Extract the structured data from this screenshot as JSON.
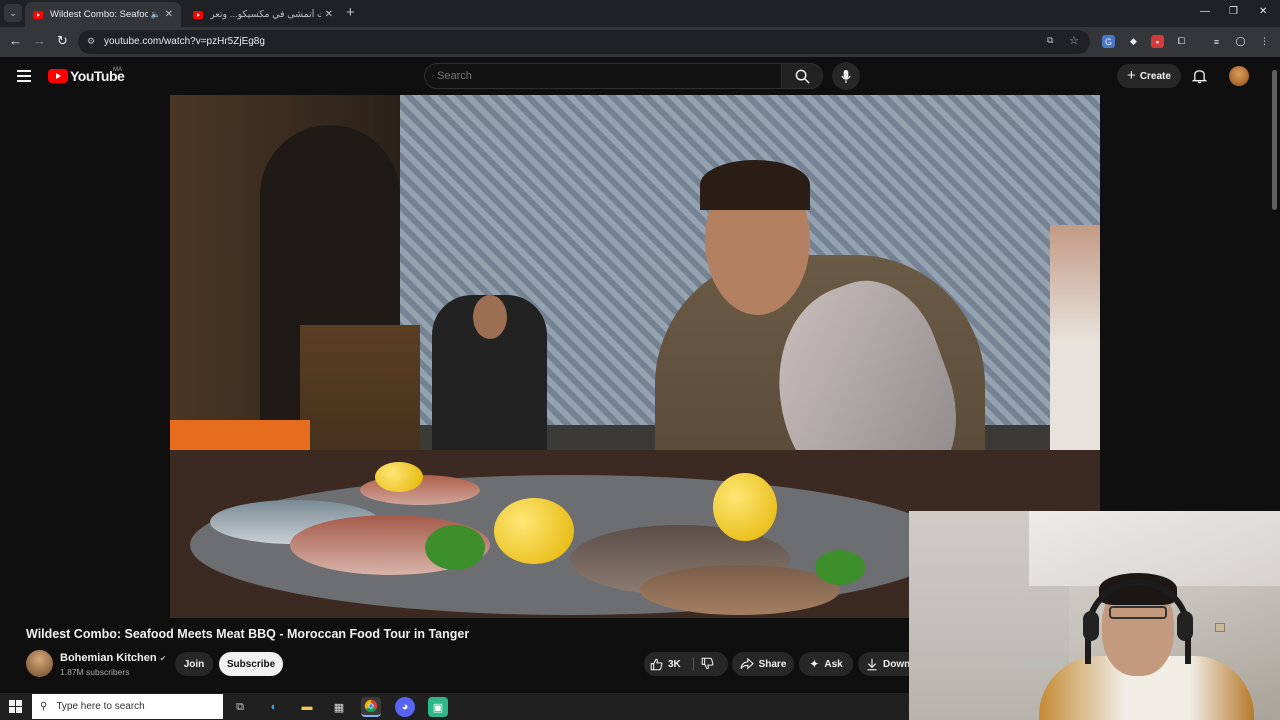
{
  "browser": {
    "tabs": [
      {
        "title": "Wildest Combo: Seafood M",
        "active": true
      },
      {
        "title": "خرجت أتمشى في مكسيكو... وتعر",
        "active": false
      }
    ],
    "tab_menu_icon": "chevron-down-icon",
    "new_tab_label": "+",
    "window_controls": [
      "—",
      "❐",
      "✕"
    ],
    "url": "youtube.com/watch?v=pzHr5ZjEg8g"
  },
  "youtube": {
    "logo_text": "YouTube",
    "country_code": "MA",
    "search_placeholder": "Search",
    "create_label": "Create"
  },
  "video": {
    "title": "Wildest Combo: Seafood Meets Meat BBQ - Moroccan Food Tour in Tanger",
    "channel_name": "Bohemian Kitchen",
    "subscribers": "1.87M subscribers",
    "join_label": "Join",
    "subscribe_label": "Subscribe",
    "like_count": "3K",
    "share_label": "Share",
    "ask_label": "Ask",
    "download_label": "Down"
  },
  "taskbar": {
    "search_placeholder": "Type here to search"
  },
  "colors": {
    "youtube_red": "#ff0000",
    "background": "#0f0f0f",
    "button_bg": "#272727",
    "subscribe_bg": "#f1f1f1"
  }
}
